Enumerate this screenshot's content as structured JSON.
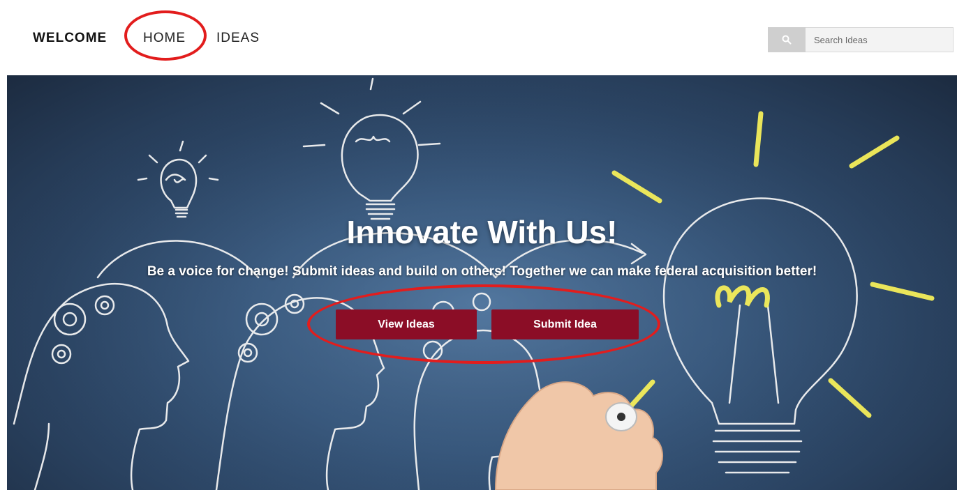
{
  "nav": {
    "brand": "WELCOME",
    "items": [
      {
        "label": "HOME"
      },
      {
        "label": "IDEAS"
      }
    ]
  },
  "search": {
    "placeholder": "Search Ideas",
    "icon": "search-icon"
  },
  "hero": {
    "title": "Innovate With Us!",
    "subtitle": "Be a voice for change! Submit ideas and build on others! Together we can make federal acquisition better!",
    "buttons": {
      "view_label": "View Ideas",
      "submit_label": "Submit Idea"
    }
  },
  "colors": {
    "button_bg": "#8b0d26",
    "annotation": "#e21d1d",
    "hero_bg": "#3a5c83",
    "bulb_glow": "#f4ee5a"
  }
}
